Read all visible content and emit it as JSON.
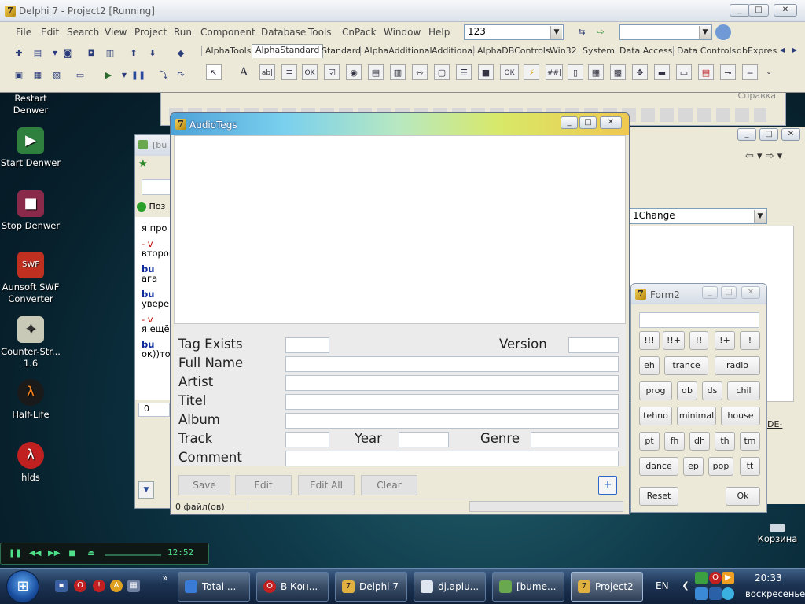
{
  "delphi": {
    "title": "Delphi 7 - Project2 [Running]",
    "menu": [
      "File",
      "Edit",
      "Search",
      "View",
      "Project",
      "Run",
      "Component",
      "Database",
      "Tools",
      "CnPack",
      "Window",
      "Help"
    ],
    "config_combo": "123",
    "palette_tabs": [
      "AlphaTools",
      "AlphaStandard",
      "Standard",
      "AlphaAdditional",
      "Additional",
      "AlphaDBControls",
      "Win32",
      "System",
      "Data Access",
      "Data Controls",
      "dbExpress"
    ],
    "active_palette_tab": "AlphaStandard",
    "palette_icon_ok": "OK",
    "behind_window_menu": "Справка"
  },
  "desktop_icons": [
    {
      "label": "Restart Denwer",
      "icon": "denwer-restart-icon"
    },
    {
      "label": "Start Denwer",
      "icon": "denwer-start-icon"
    },
    {
      "label": "Stop Denwer",
      "icon": "denwer-stop-icon"
    },
    {
      "label": "Aunsoft SWF Converter",
      "icon": "swf-converter-icon"
    },
    {
      "label": "Counter-Str... 1.6",
      "icon": "counter-strike-icon"
    },
    {
      "label": "Half-Life",
      "icon": "half-life-icon"
    },
    {
      "label": "hlds",
      "icon": "hlds-icon"
    },
    {
      "label": "Корзина",
      "icon": "recycle-bin-icon"
    }
  ],
  "background_chat": {
    "title": "[bu",
    "lines": [
      "я про",
      "- v",
      "второй",
      "bu",
      "ага",
      "bu",
      "уверен",
      "- v",
      "я ещё",
      "bu",
      "ок))то"
    ],
    "status_prefix": "Поз",
    "counter": "0"
  },
  "background_right": {
    "combo_value": "1Change",
    "label": "DE-"
  },
  "audiotegs": {
    "title": "AudioTegs",
    "labels": {
      "tag_exists": "Tag Exists",
      "version": "Version",
      "full_name": "Full Name",
      "artist": "Artist",
      "titel": "Titel",
      "album": "Album",
      "track": "Track",
      "year": "Year",
      "genre": "Genre",
      "comment": "Comment"
    },
    "buttons": {
      "save": "Save",
      "edit": "Edit",
      "edit_all": "Edit All",
      "clear": "Clear",
      "add": "+"
    },
    "status": "0 файл(ов)"
  },
  "form2": {
    "title": "Form2",
    "buttons": [
      "!!!",
      "!!+",
      "!!",
      "!+",
      "!",
      "eh",
      "trance",
      "radio",
      "prog",
      "db",
      "ds",
      "chil",
      "tehno",
      "minimal",
      "house",
      "pt",
      "fh",
      "dh",
      "th",
      "tm",
      "dance",
      "ep",
      "pop",
      "tt"
    ],
    "reset": "Reset",
    "ok": "Ok"
  },
  "player": {
    "time": "12:52"
  },
  "taskbar": {
    "buttons": [
      {
        "label": "Total ...",
        "icon": "total-commander-icon"
      },
      {
        "label": "В Кон...",
        "icon": "opera-icon"
      },
      {
        "label": "Delphi 7",
        "icon": "delphi-icon"
      },
      {
        "label": "dj.aplu...",
        "icon": "window-icon"
      },
      {
        "label": "[bume...",
        "icon": "chat-icon"
      },
      {
        "label": "Project2",
        "icon": "delphi-icon",
        "active": true
      }
    ],
    "language": "EN",
    "time": "20:33",
    "day": "воскресенье"
  },
  "colors": {
    "accent": "#2c66c8",
    "titlebar_gradient_start": "#4da2d8",
    "taskbar": "#1d3453"
  }
}
